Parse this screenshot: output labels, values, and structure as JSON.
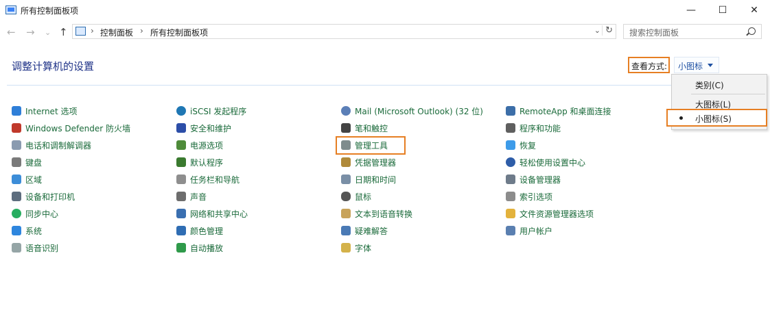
{
  "window": {
    "title": "所有控制面板项",
    "minimize": "—",
    "maximize": "☐",
    "close": "✕"
  },
  "address": {
    "crumbs": [
      "控制面板",
      "所有控制面板项"
    ],
    "back": "←",
    "forward": "→",
    "recent": "⌄",
    "up": "↑",
    "dropdown": "⌄",
    "refresh": "↻"
  },
  "search": {
    "placeholder": "搜索控制面板"
  },
  "heading": "调整计算机的设置",
  "view": {
    "label": "查看方式:",
    "selected": "小图标",
    "options": [
      "类别(C)",
      "大图标(L)",
      "小图标(S)"
    ]
  },
  "items": {
    "col1": [
      "Internet 选项",
      "Windows Defender 防火墙",
      "电话和调制解调器",
      "键盘",
      "区域",
      "设备和打印机",
      "同步中心",
      "系统",
      "语音识别"
    ],
    "col2": [
      "iSCSI 发起程序",
      "安全和维护",
      "电源选项",
      "默认程序",
      "任务栏和导航",
      "声音",
      "网络和共享中心",
      "颜色管理",
      "自动播放"
    ],
    "col3": [
      "Mail (Microsoft Outlook) (32 位)",
      "笔和触控",
      "管理工具",
      "凭据管理器",
      "日期和时间",
      "鼠标",
      "文本到语音转换",
      "疑难解答",
      "字体"
    ],
    "col4": [
      "RemoteApp 和桌面连接",
      "程序和功能",
      "恢复",
      "轻松使用设置中心",
      "设备管理器",
      "索引选项",
      "文件资源管理器选项",
      "用户帐户"
    ]
  },
  "colors": {
    "link": "#1a6a3a",
    "heading": "#1e3287",
    "highlight": "#e67e22"
  }
}
